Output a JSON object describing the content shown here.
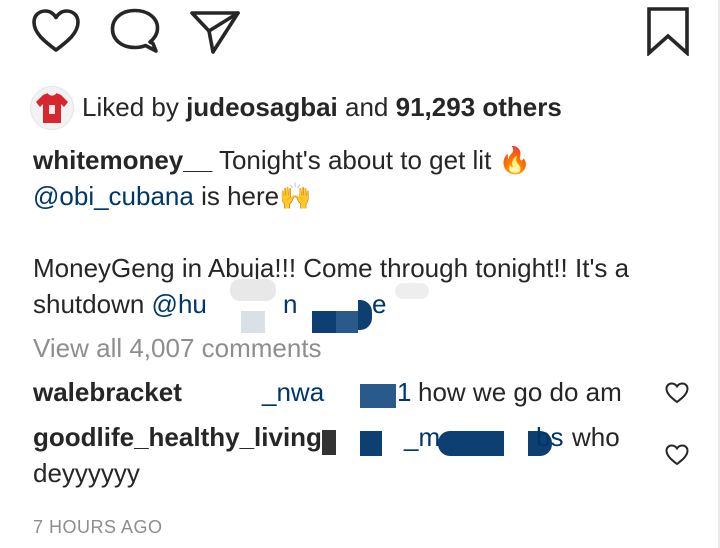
{
  "actions": {
    "like_icon": "heart-outline",
    "comment_icon": "comment-bubble",
    "share_icon": "paper-plane",
    "save_icon": "bookmark-outline"
  },
  "likes": {
    "prefix": "Liked by",
    "user": "judeosagbai",
    "conjunction": "and",
    "count": "91,293 others"
  },
  "caption": {
    "username": "whitemoney__",
    "line1_text": "Tonight's about to get lit",
    "line1_emoji": "🔥",
    "line2_mention": "@obi_cubana",
    "line2_text": "is here",
    "line2_emoji": "🙌",
    "line3_text": "MoneyGeng in Abuja!!! Come through tonight!! It's a",
    "line4_text": "shutdown",
    "line4_mention_fragment": "@hu",
    "line4_mention_fragment2": "n",
    "line4_mention_fragment3": "e"
  },
  "view_all_comments": "View all 4,007 comments",
  "comments": [
    {
      "username": "walebracket",
      "mention_fragment": "_nwa",
      "mention_fragment2": "1",
      "text": "how we go do am"
    },
    {
      "username": "goodlife_healthy_living",
      "mention_fragment": "_m",
      "mention_fragment2": "bs",
      "text": "who",
      "text_line2": "deyyyyyy"
    }
  ],
  "timestamp": "7 HOURS AGO",
  "colors": {
    "text": "#262626",
    "mention": "#00376b",
    "muted": "#8e8e8e",
    "redact_dark": "#0e3f73",
    "redact_light": "#d9e0e8"
  }
}
